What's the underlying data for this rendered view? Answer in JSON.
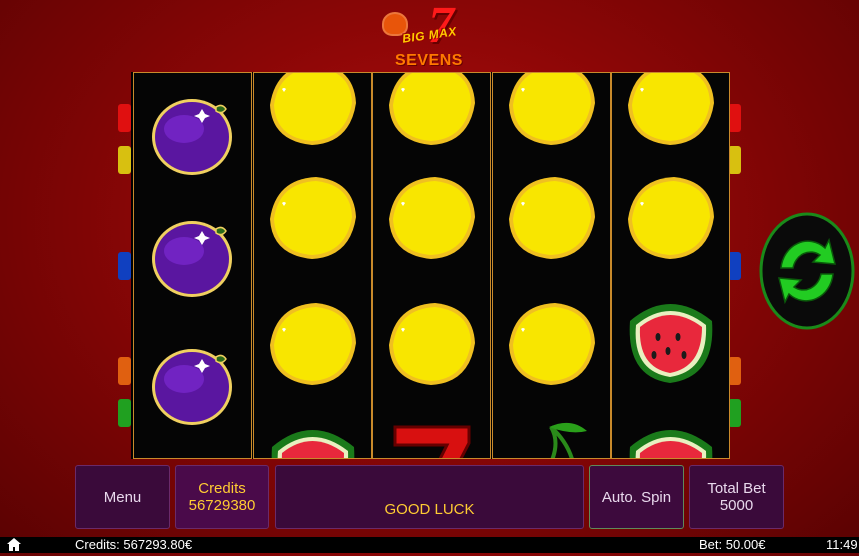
{
  "logo": {
    "line1": "BIG MAX",
    "digit": "7",
    "line2": "SEVENS"
  },
  "reels": [
    [
      "plum",
      "plum",
      "plum"
    ],
    [
      "lemon",
      "lemon",
      "lemon",
      "watermelon"
    ],
    [
      "lemon",
      "lemon",
      "lemon",
      "seven"
    ],
    [
      "lemon",
      "lemon",
      "lemon",
      "cherry"
    ],
    [
      "lemon",
      "lemon",
      "watermelon",
      "watermelon"
    ]
  ],
  "line_markers": {
    "left": [
      "#e01010",
      "#d8c010",
      "#1040c0",
      "#e06010",
      "#20a020"
    ],
    "right": [
      "#e01010",
      "#d8c010",
      "#1040c0",
      "#e06010",
      "#20a020"
    ]
  },
  "buttons": {
    "menu": "Menu",
    "credits_label": "Credits",
    "credits_value": "56729380",
    "message": "GOOD LUCK",
    "auto_spin": "Auto. Spin",
    "total_bet_label": "Total Bet",
    "total_bet_value": "5000"
  },
  "spin_button": {
    "icon": "refresh-arrows-icon",
    "color": "#22cc22"
  },
  "status_bar": {
    "home_icon": "home-icon",
    "credits": "Credits: 567293.80€",
    "bet": "Bet: 50.00€",
    "time": "11:49"
  }
}
